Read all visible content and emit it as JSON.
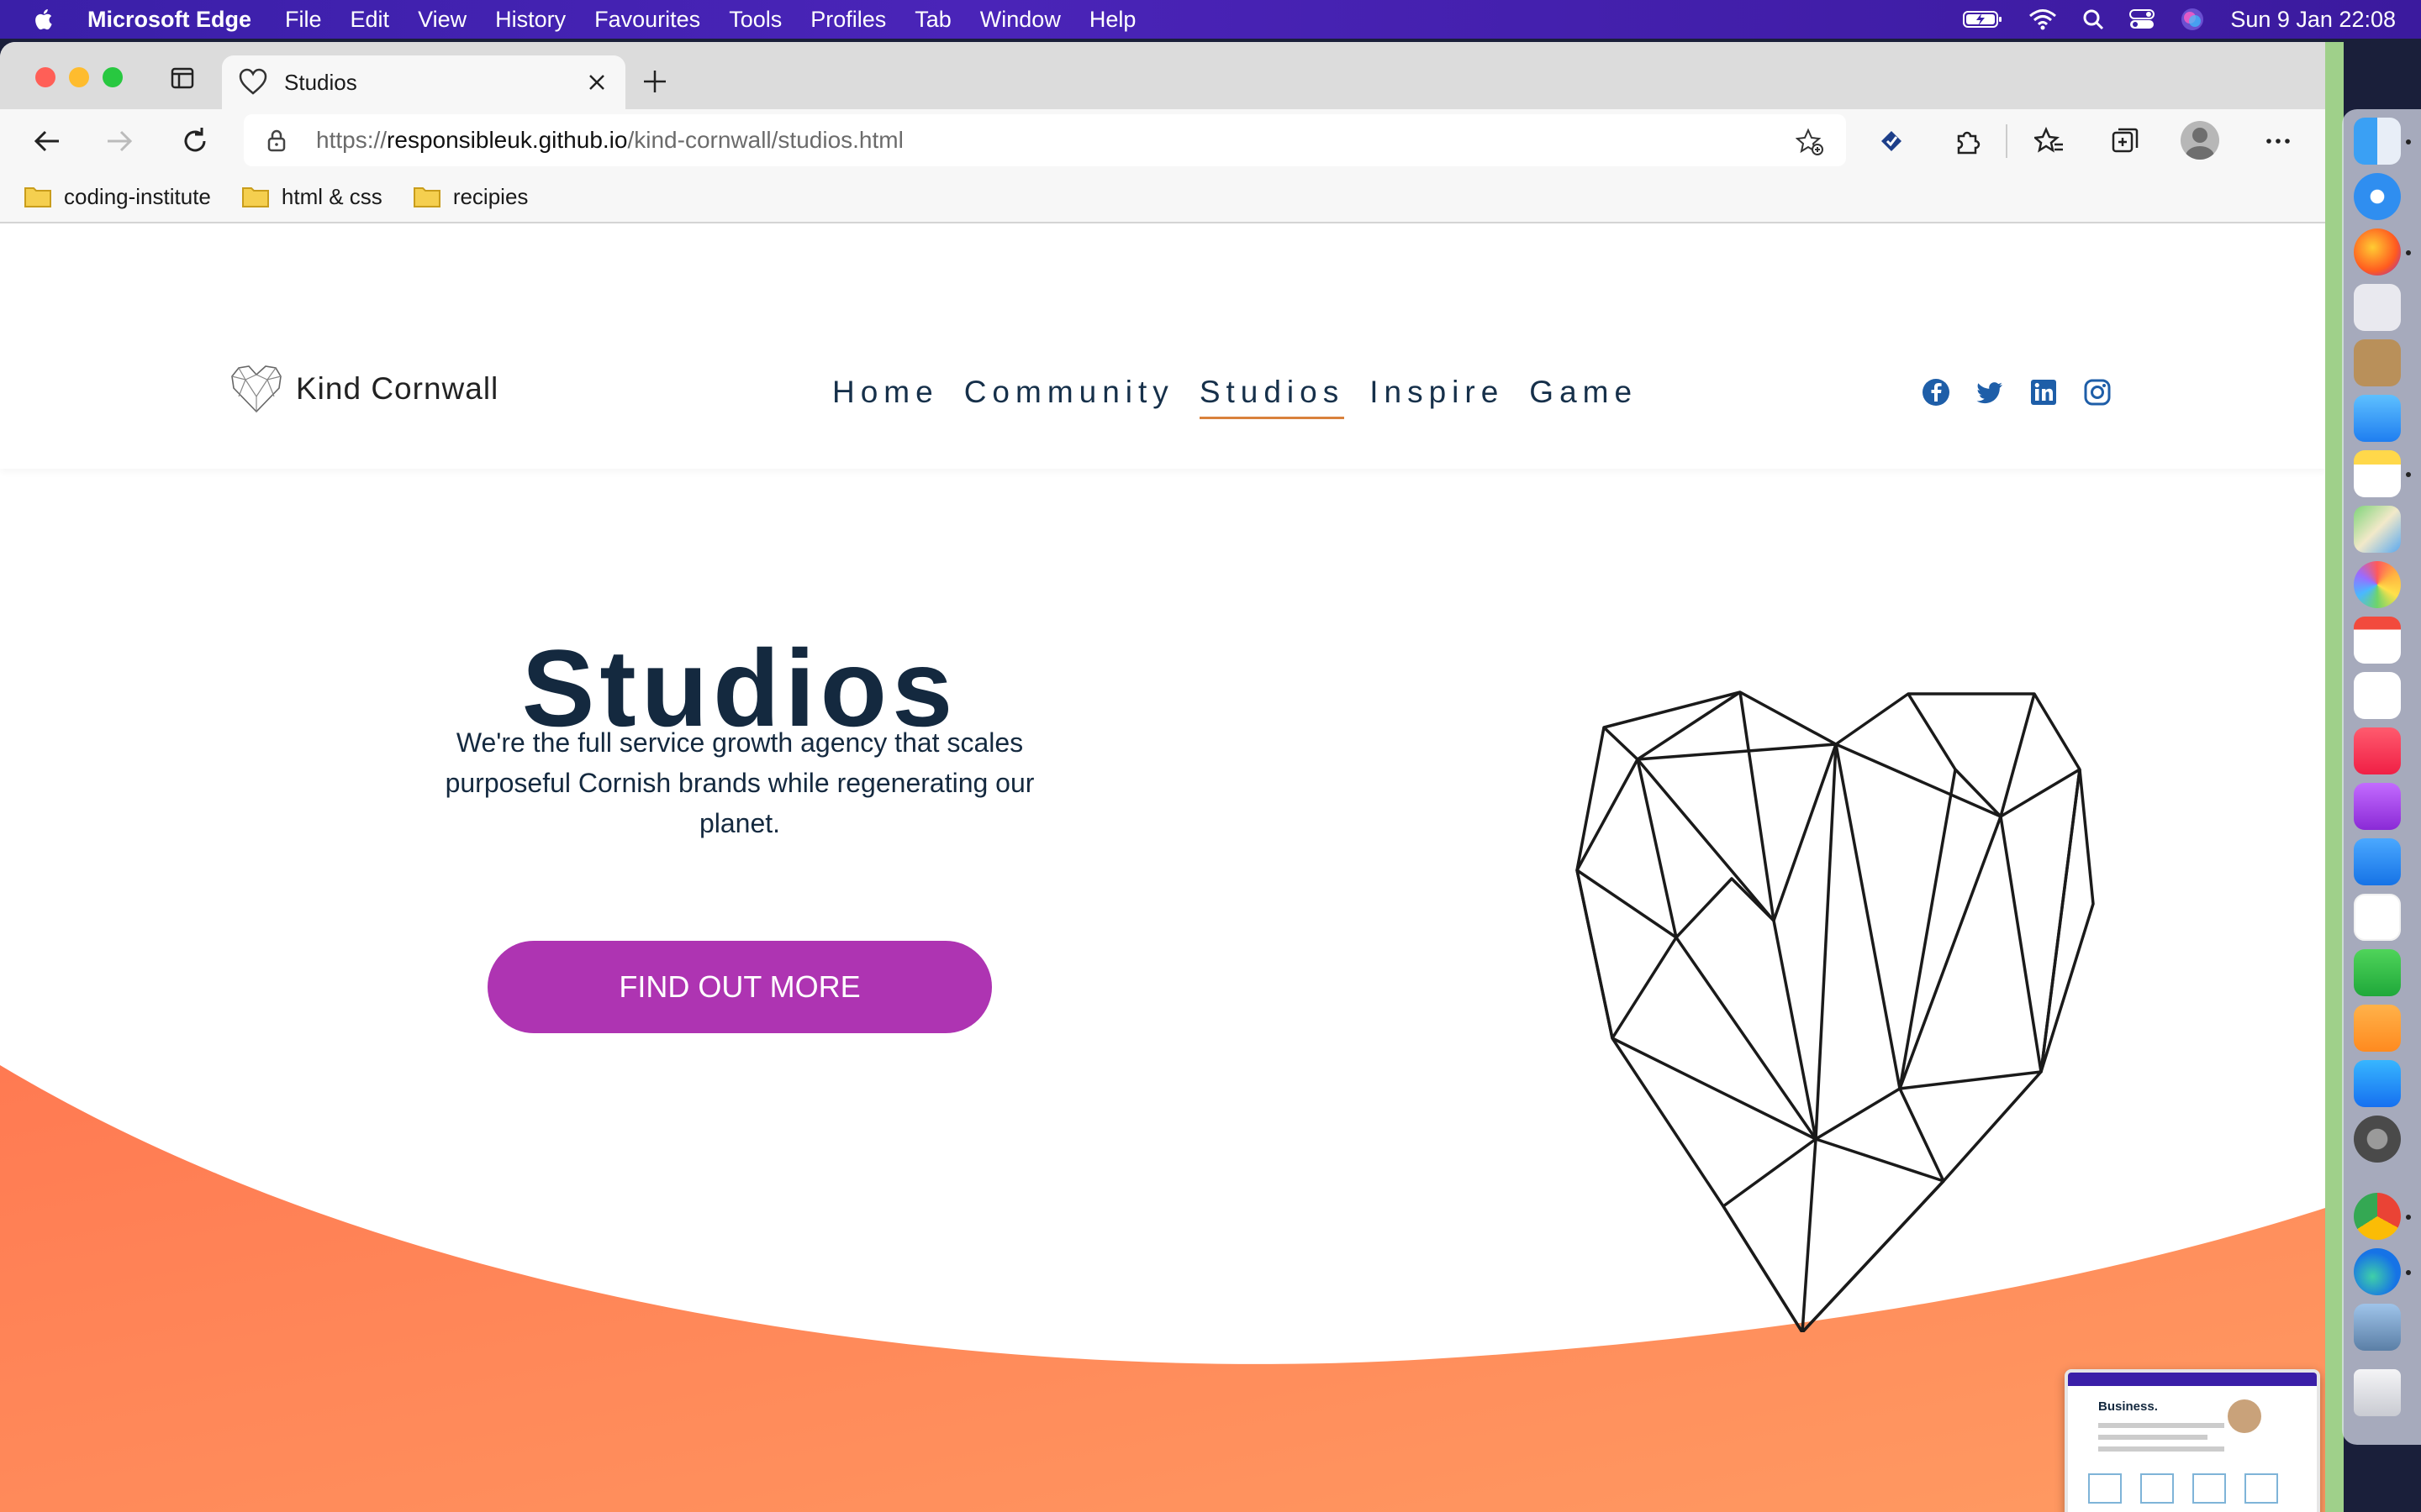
{
  "menubar": {
    "app_name": "Microsoft Edge",
    "items": [
      "File",
      "Edit",
      "View",
      "History",
      "Favourites",
      "Tools",
      "Profiles",
      "Tab",
      "Window",
      "Help"
    ],
    "datetime": "Sun 9 Jan  22:08"
  },
  "browser": {
    "tab_title": "Studios",
    "url_scheme": "https://",
    "url_host": "responsibleuk.github.io",
    "url_path": "/kind-cornwall/studios.html",
    "bookmarks": [
      "coding-institute",
      "html & css",
      "recipies"
    ]
  },
  "site": {
    "logo_text": "Kind Cornwall",
    "nav": [
      "Home",
      "Community",
      "Studios",
      "Inspire",
      "Game"
    ],
    "active_nav": "Studios",
    "social_icons": [
      "facebook-icon",
      "twitter-icon",
      "linkedin-icon",
      "instagram-icon"
    ],
    "hero": {
      "title": "Studios",
      "subtitle": "We're the full service growth agency that scales purposeful Cornish brands while regenerating our planet.",
      "cta": "FIND OUT MORE"
    }
  },
  "thumbnail": {
    "title": "Business."
  },
  "colors": {
    "menubar": "#3a1fa8",
    "cta": "#ae34b2",
    "nav_text": "#16304a",
    "active_underline": "#d9823c",
    "wave": "#ff8a5b",
    "heading": "#14293f"
  }
}
